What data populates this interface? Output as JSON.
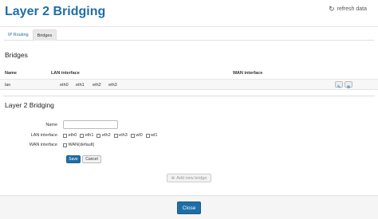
{
  "header": {
    "title": "Layer 2 Bridging",
    "refresh_label": "refresh data",
    "refresh_icon": "refresh-icon"
  },
  "tabs": [
    {
      "label": "IP Routing",
      "active": false
    },
    {
      "label": "Bridges",
      "active": true
    }
  ],
  "bridges": {
    "title": "Bridges",
    "columns": [
      "Name",
      "LAN interface",
      "WAN interface"
    ],
    "rows": [
      {
        "name": "lan",
        "lan_interfaces": [
          "eth0",
          "eth1",
          "eth2",
          "eth3"
        ],
        "wan_interface": ""
      }
    ]
  },
  "form": {
    "title": "Layer 2 Bridging",
    "name_label": "Name",
    "name_value": "",
    "lan_label": "LAN interface",
    "lan_options": [
      "eth0",
      "eth1",
      "eth2",
      "eth3",
      "wl0",
      "wl1"
    ],
    "wan_label": "WAN interface",
    "wan_options": [
      "WAN(default)"
    ],
    "save_label": "Save",
    "cancel_label": "Cancel"
  },
  "add_bridge_label": "Add new bridge",
  "close_label": "Close",
  "colors": {
    "accent": "#1e6ea7"
  }
}
